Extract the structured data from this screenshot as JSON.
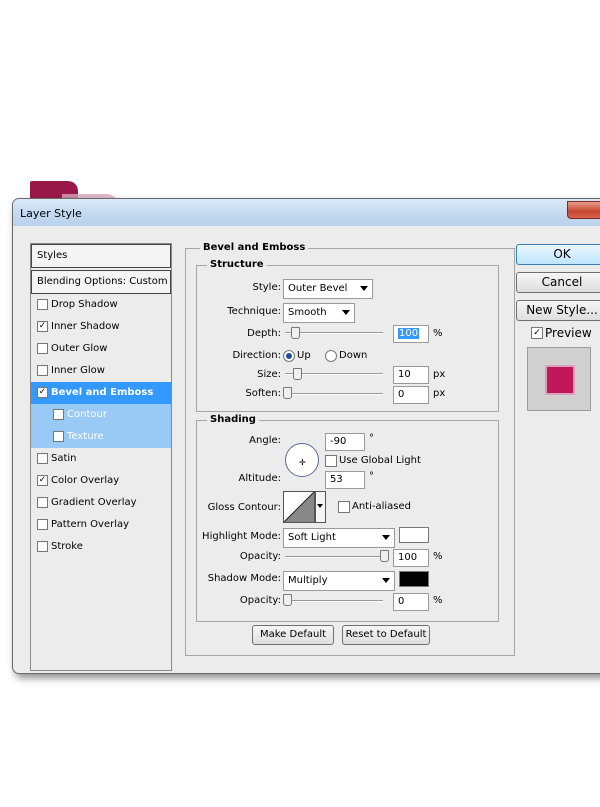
{
  "dialog": {
    "title": "Layer Style"
  },
  "styles": {
    "header": "Styles",
    "blending": "Blending Options: Custom",
    "items": [
      {
        "label": "Drop Shadow",
        "checked": false
      },
      {
        "label": "Inner Shadow",
        "checked": true
      },
      {
        "label": "Outer Glow",
        "checked": false
      },
      {
        "label": "Inner Glow",
        "checked": false
      },
      {
        "label": "Bevel and Emboss",
        "checked": true,
        "selected": true
      },
      {
        "label": "Contour",
        "checked": false,
        "sub": true
      },
      {
        "label": "Texture",
        "checked": false,
        "sub": true
      },
      {
        "label": "Satin",
        "checked": false
      },
      {
        "label": "Color Overlay",
        "checked": true
      },
      {
        "label": "Gradient Overlay",
        "checked": false
      },
      {
        "label": "Pattern Overlay",
        "checked": false
      },
      {
        "label": "Stroke",
        "checked": false
      }
    ]
  },
  "bevel": {
    "title": "Bevel and Emboss",
    "structure": {
      "title": "Structure",
      "style_label": "Style:",
      "style_value": "Outer Bevel",
      "technique_label": "Technique:",
      "technique_value": "Smooth",
      "depth_label": "Depth:",
      "depth_value": "100",
      "depth_unit": "%",
      "direction_label": "Direction:",
      "direction_up": "Up",
      "direction_down": "Down",
      "size_label": "Size:",
      "size_value": "10",
      "size_unit": "px",
      "soften_label": "Soften:",
      "soften_value": "0",
      "soften_unit": "px"
    },
    "shading": {
      "title": "Shading",
      "angle_label": "Angle:",
      "angle_value": "-90",
      "angle_unit": "°",
      "global_light_label": "Use Global Light",
      "altitude_label": "Altitude:",
      "altitude_value": "53",
      "altitude_unit": "°",
      "gloss_label": "Gloss Contour:",
      "antialiased_label": "Anti-aliased",
      "highlight_label": "Highlight Mode:",
      "highlight_value": "Soft Light",
      "highlight_color": "#ffffff",
      "highlight_opacity_label": "Opacity:",
      "highlight_opacity_value": "100",
      "highlight_opacity_unit": "%",
      "shadow_label": "Shadow Mode:",
      "shadow_value": "Multiply",
      "shadow_color": "#000000",
      "shadow_opacity_label": "Opacity:",
      "shadow_opacity_value": "0",
      "shadow_opacity_unit": "%"
    },
    "make_default": "Make Default",
    "reset_default": "Reset to Default"
  },
  "actions": {
    "ok": "OK",
    "cancel": "Cancel",
    "new_style": "New Style...",
    "preview_label": "Preview",
    "preview_checked": true
  },
  "colors": {
    "preview_swatch": "#c1185a",
    "accent": "#3399ff"
  }
}
